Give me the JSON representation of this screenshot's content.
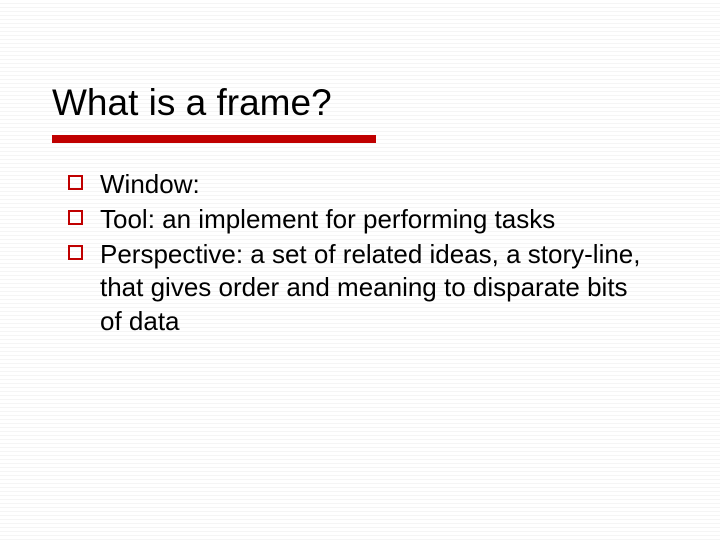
{
  "title": "What is a frame?",
  "bullets": [
    {
      "text": "Window:"
    },
    {
      "text": "Tool: an implement for performing tasks"
    },
    {
      "text": "Perspective: a set of related ideas, a story-line, that gives order and meaning to disparate bits of data"
    }
  ]
}
